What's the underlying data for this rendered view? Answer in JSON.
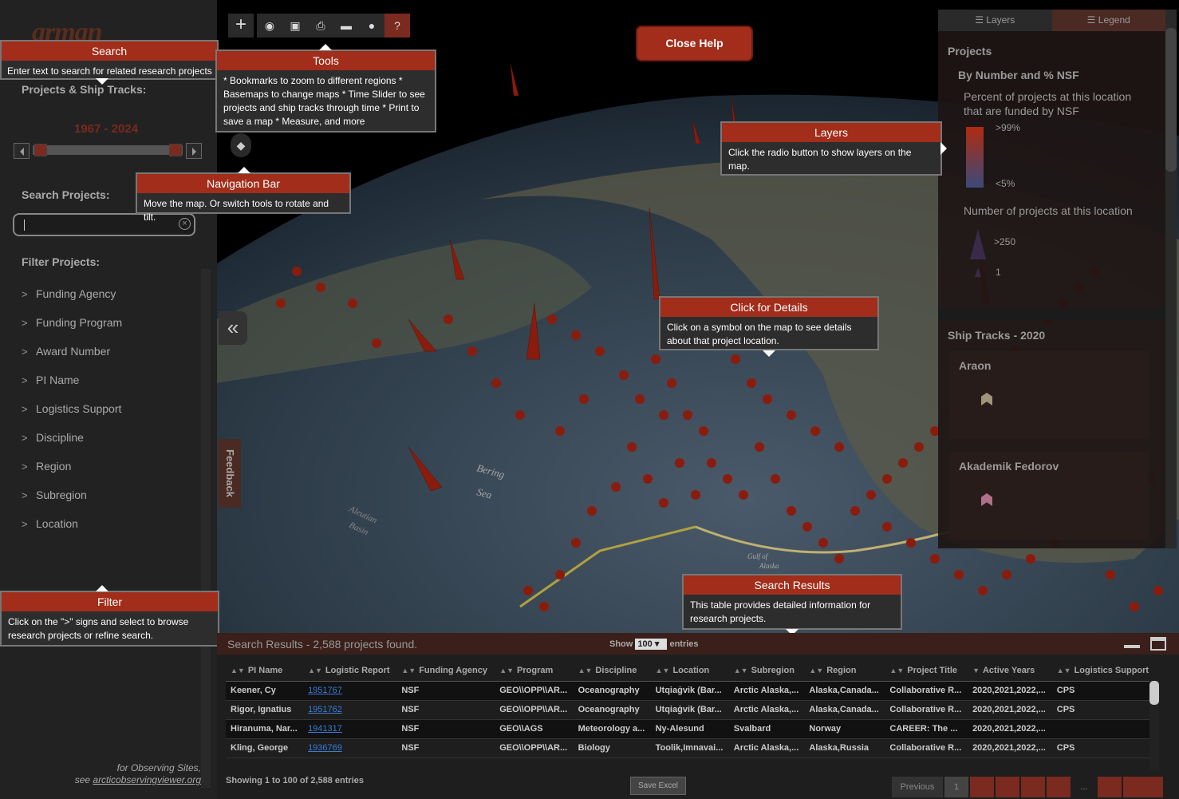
{
  "app": {
    "logo": "arman"
  },
  "sidebar": {
    "tracks_label": "Projects & Ship Tracks:",
    "years": "1967 - 2024",
    "search_label": "Search Projects:",
    "filter_label": "Filter Projects:",
    "filters": [
      "Funding Agency",
      "Funding Program",
      "Award Number",
      "PI Name",
      "Logistics Support",
      "Discipline",
      "Region",
      "Subregion",
      "Location"
    ],
    "footer_line1": "for Observing Sites,",
    "footer_see": "see ",
    "footer_link": "arcticobservingviewer.org"
  },
  "toolbar": {
    "icons": [
      "globe-icon",
      "basemap-icon",
      "print-icon",
      "measure-icon",
      "bookmark-pin-icon",
      "help-icon"
    ],
    "plus": "+",
    "compass": "◆",
    "collapse": "«",
    "feedback": "Feedback"
  },
  "help": {
    "close_button": "Close Help",
    "search_title": "Search",
    "search_body": "Enter text to search for related research projects",
    "tools_title": "Tools",
    "tools_body": "* Bookmarks to zoom to different regions * Basemaps to change maps * Time Slider to see projects and ship tracks through time * Print to save a map * Measure, and more",
    "nav_title": "Navigation Bar",
    "nav_body": "Move the map. Or switch tools to rotate and tilt.",
    "layers_title": "Layers",
    "layers_body": "Click the radio button to show layers on the map.",
    "details_title": "Click for Details",
    "details_body": "Click on a symbol on the map to see details about that project location.",
    "results_title": "Search Results",
    "results_body": "This table provides detailed information for research projects.",
    "filter_title": "Filter",
    "filter_body": "Click on the \">\" signs and select to browse research projects or refine search."
  },
  "layer_panel": {
    "tab_layers": "Layers",
    "tab_legend": "Legend",
    "projects": "Projects",
    "by_number": "By Number and % NSF",
    "percent_desc": "Percent of projects at this location that are funded by NSF",
    "pct_high": ">99%",
    "pct_low": "<5%",
    "number_desc": "Number of projects at this location",
    "num_high": ">250",
    "num_low": "1",
    "ship_tracks": "Ship Tracks - 2020",
    "ship1": "Araon",
    "ship2": "Akademik Fedorov"
  },
  "map_labels": {
    "bering": "Bering",
    "sea": "Sea",
    "aleutian": "Aleutian",
    "basin": "Basin",
    "gulf": "Gulf of",
    "alaska": "Alaska"
  },
  "results": {
    "title": "Search Results - 2,588 projects found.",
    "show": "Show",
    "show_value": "100",
    "entries": "entries",
    "columns": [
      "PI Name",
      "Logistic Report",
      "Funding Agency",
      "Program",
      "Discipline",
      "Location",
      "Subregion",
      "Region",
      "Project Title",
      "Active Years",
      "Logistics Support"
    ],
    "rows": [
      {
        "pi": "Keener, Cy",
        "report": "1951767",
        "agency": "NSF",
        "program": "GEO\\\\OPP\\\\AR...",
        "discipline": "Oceanography",
        "location": "Utqiaġvik (Bar...",
        "subregion": "Arctic Alaska,...",
        "region": "Alaska,Canada...",
        "title": "Collaborative R...",
        "years": "2020,2021,2022,...",
        "support": "CPS"
      },
      {
        "pi": "Rigor, Ignatius",
        "report": "1951762",
        "agency": "NSF",
        "program": "GEO\\\\OPP\\\\AR...",
        "discipline": "Oceanography",
        "location": "Utqiaġvik (Bar...",
        "subregion": "Arctic Alaska,...",
        "region": "Alaska,Canada...",
        "title": "Collaborative R...",
        "years": "2020,2021,2022,...",
        "support": "CPS"
      },
      {
        "pi": "Hiranuma, Nar...",
        "report": "1941317",
        "agency": "NSF",
        "program": "GEO\\\\AGS",
        "discipline": "Meteorology a...",
        "location": "Ny-Alesund",
        "subregion": "Svalbard",
        "region": "Norway",
        "title": "CAREER: The ...",
        "years": "2020,2021,2022,...",
        "support": ""
      },
      {
        "pi": "Kling, George",
        "report": "1936769",
        "agency": "NSF",
        "program": "GEO\\\\OPP\\\\AR...",
        "discipline": "Biology",
        "location": "Toolik,Imnavai...",
        "subregion": "Arctic Alaska,...",
        "region": "Alaska,Russia",
        "title": "Collaborative R...",
        "years": "2020,2021,2022,...",
        "support": "CPS"
      }
    ],
    "footer": "Showing 1 to 100 of 2,588 entries",
    "save_excel": "Save Excel",
    "prev": "Previous",
    "pages": [
      "1",
      "2",
      "3",
      "4",
      "5",
      "...",
      "26"
    ],
    "next": "Next"
  }
}
